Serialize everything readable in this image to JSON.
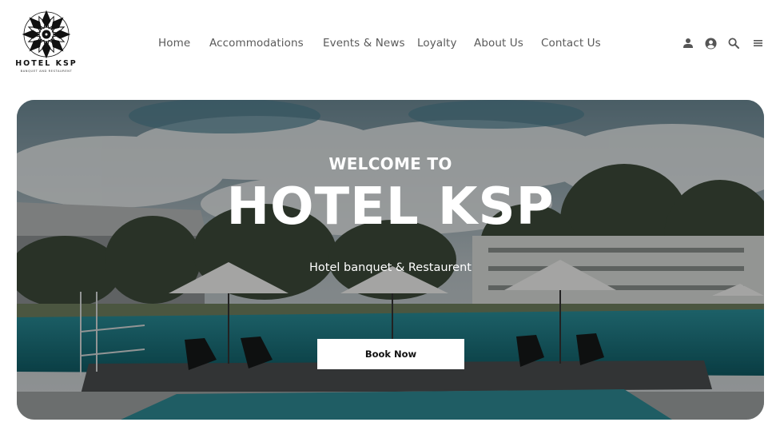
{
  "brand": {
    "name": "HOTEL KSP",
    "tagline": "BANQUET AND RESTAURENT"
  },
  "nav": {
    "items": [
      {
        "label": "Home"
      },
      {
        "label": "Accommodations"
      },
      {
        "label": "Events & News"
      },
      {
        "label": "Loyalty"
      },
      {
        "label": "About Us"
      },
      {
        "label": "Contact Us"
      }
    ]
  },
  "header_icons": [
    "user-icon",
    "account-circle-icon",
    "search-icon",
    "menu-icon"
  ],
  "hero": {
    "welcome": "WELCOME TO",
    "title": "HOTEL KSP",
    "subtitle": "Hotel banquet & Restaurent",
    "button_label": "Book Now"
  },
  "colors": {
    "nav_text": "#5a5a5a",
    "icon": "#555555",
    "button_bg": "#ffffff",
    "button_text": "#111111",
    "hero_text": "#ffffff"
  }
}
